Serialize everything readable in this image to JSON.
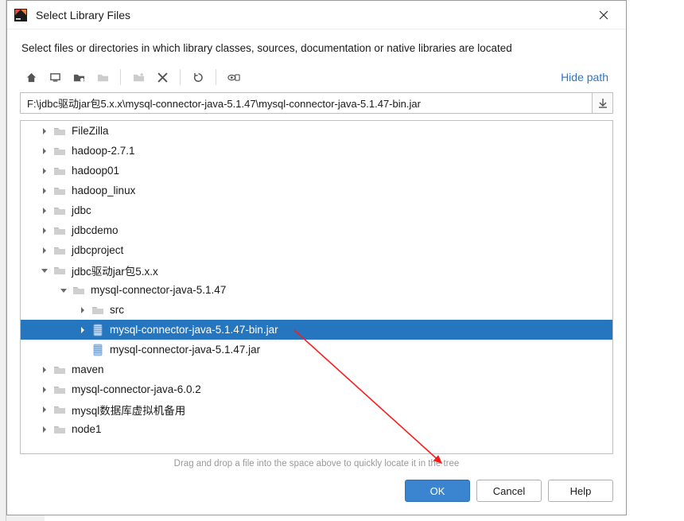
{
  "titlebar": {
    "title": "Select Library Files",
    "close_label": "✕"
  },
  "subtitle": "Select files or directories in which library classes, sources, documentation or native libraries are located",
  "toolbar": {
    "hide_path_label": "Hide path"
  },
  "path": {
    "value": "F:\\jdbc驱动jar包5.x.x\\mysql-connector-java-5.1.47\\mysql-connector-java-5.1.47-bin.jar"
  },
  "tree": {
    "items": [
      {
        "depth": 1,
        "expander": "right",
        "icon": "folder",
        "label": "FileZilla",
        "selected": false
      },
      {
        "depth": 1,
        "expander": "right",
        "icon": "folder",
        "label": "hadoop-2.7.1",
        "selected": false
      },
      {
        "depth": 1,
        "expander": "right",
        "icon": "folder",
        "label": "hadoop01",
        "selected": false
      },
      {
        "depth": 1,
        "expander": "right",
        "icon": "folder",
        "label": "hadoop_linux",
        "selected": false
      },
      {
        "depth": 1,
        "expander": "right",
        "icon": "folder",
        "label": "jdbc",
        "selected": false
      },
      {
        "depth": 1,
        "expander": "right",
        "icon": "folder",
        "label": "jdbcdemo",
        "selected": false
      },
      {
        "depth": 1,
        "expander": "right",
        "icon": "folder",
        "label": "jdbcproject",
        "selected": false
      },
      {
        "depth": 1,
        "expander": "down",
        "icon": "folder",
        "label": "jdbc驱动jar包5.x.x",
        "selected": false
      },
      {
        "depth": 2,
        "expander": "down",
        "icon": "folder",
        "label": "mysql-connector-java-5.1.47",
        "selected": false
      },
      {
        "depth": 3,
        "expander": "right",
        "icon": "folder",
        "label": "src",
        "selected": false
      },
      {
        "depth": 3,
        "expander": "right",
        "icon": "jar",
        "label": "mysql-connector-java-5.1.47-bin.jar",
        "selected": true
      },
      {
        "depth": 3,
        "expander": "none",
        "icon": "jar",
        "label": "mysql-connector-java-5.1.47.jar",
        "selected": false
      },
      {
        "depth": 1,
        "expander": "right",
        "icon": "folder",
        "label": "maven",
        "selected": false
      },
      {
        "depth": 1,
        "expander": "right",
        "icon": "folder",
        "label": "mysql-connector-java-6.0.2",
        "selected": false
      },
      {
        "depth": 1,
        "expander": "right",
        "icon": "folder",
        "label": "mysql数据库虚拟机备用",
        "selected": false
      },
      {
        "depth": 1,
        "expander": "right",
        "icon": "folder",
        "label": "node1",
        "selected": false
      }
    ]
  },
  "hint": "Drag and drop a file into the space above to quickly locate it in the tree",
  "buttons": {
    "ok": "OK",
    "cancel": "Cancel",
    "help": "Help"
  }
}
